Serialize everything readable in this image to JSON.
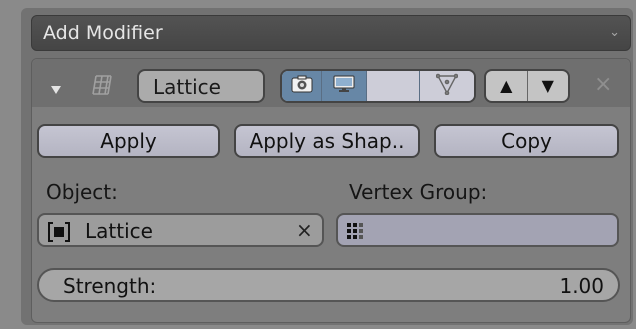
{
  "add_modifier": {
    "label": "Add Modifier"
  },
  "modifier": {
    "name": "Lattice",
    "visibility": [
      {
        "icon": "camera-render-icon",
        "state": "on"
      },
      {
        "icon": "monitor-viewport-icon",
        "state": "on"
      },
      {
        "icon": "edit-mode-icon",
        "state": "off"
      },
      {
        "icon": "on-cage-icon",
        "state": "off"
      }
    ],
    "move_up": "▲",
    "move_down": "▼",
    "remove": "×"
  },
  "actions": {
    "apply": "Apply",
    "apply_as_shape": "Apply as Shap..",
    "copy": "Copy"
  },
  "object": {
    "label": "Object:",
    "value": "Lattice",
    "clear": "×"
  },
  "vertex_group": {
    "label": "Vertex Group:",
    "value": ""
  },
  "strength": {
    "label": "Strength:",
    "value": "1.00"
  },
  "colors": {
    "frame_bg": "#727272",
    "panel_bg": "#7e7e7e",
    "toggle_on": "#6787a6",
    "button_bg": "#bcbcc8"
  }
}
